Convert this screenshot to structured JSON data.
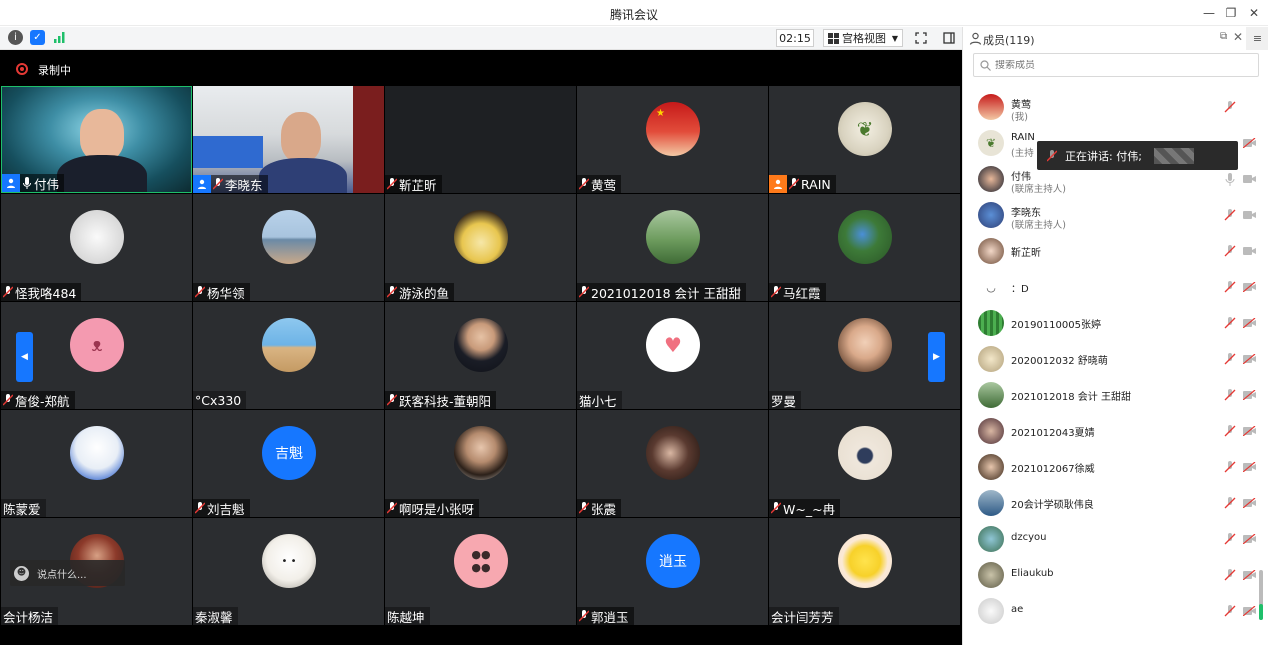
{
  "window": {
    "title": "腾讯会议"
  },
  "toolbar": {
    "timer": "02:15",
    "view_label": "宫格视图"
  },
  "recording": {
    "label": "录制中"
  },
  "tiles": [
    {
      "name": "付伟"
    },
    {
      "name": "李晓东"
    },
    {
      "name": "靳芷昕"
    },
    {
      "name": "黄莺"
    },
    {
      "name": "RAIN"
    },
    {
      "name": "怪我咯484"
    },
    {
      "name": "杨华领"
    },
    {
      "name": "游泳的鱼"
    },
    {
      "name": "2021012018 会计 王甜甜"
    },
    {
      "name": "马红霞"
    },
    {
      "name": "詹俊-郑航"
    },
    {
      "name": "°Cx330"
    },
    {
      "name": "跃客科技-董朝阳"
    },
    {
      "name": "猫小七"
    },
    {
      "name": "罗曼"
    },
    {
      "name": "陈蒙爱"
    },
    {
      "name": "刘吉魁",
      "avatar_text": "吉魁"
    },
    {
      "name": "啊呀是小张呀"
    },
    {
      "name": "张震"
    },
    {
      "name": "W~_~冉"
    },
    {
      "name": "会计杨洁"
    },
    {
      "name": "秦淑馨"
    },
    {
      "name": "陈越坤"
    },
    {
      "name": "郭逍玉",
      "avatar_text": "逍玉"
    },
    {
      "name": "会计闫芳芳"
    }
  ],
  "chat": {
    "placeholder": "说点什么..."
  },
  "panel": {
    "title": "成员(119)",
    "search_placeholder": "搜索成员",
    "toast": "正在讲话: 付伟;",
    "members": [
      {
        "name": "黄莺",
        "sub": "(我)"
      },
      {
        "name": "RAIN",
        "sub": "(主持"
      },
      {
        "name": "付伟",
        "sub": "(联席主持人)"
      },
      {
        "name": "李晓东",
        "sub": "(联席主持人)"
      },
      {
        "name": "靳芷昕"
      },
      {
        "name": "：D"
      },
      {
        "name": "20190110005张婷"
      },
      {
        "name": "2020012032 舒晓萌"
      },
      {
        "name": "2021012018 会计 王甜甜"
      },
      {
        "name": "2021012043夏婧"
      },
      {
        "name": "2021012067徐威"
      },
      {
        "name": "20会计学硕耿伟良"
      },
      {
        "name": "dzcyou"
      },
      {
        "name": "Eliaukub"
      },
      {
        "name": "ae"
      }
    ]
  }
}
